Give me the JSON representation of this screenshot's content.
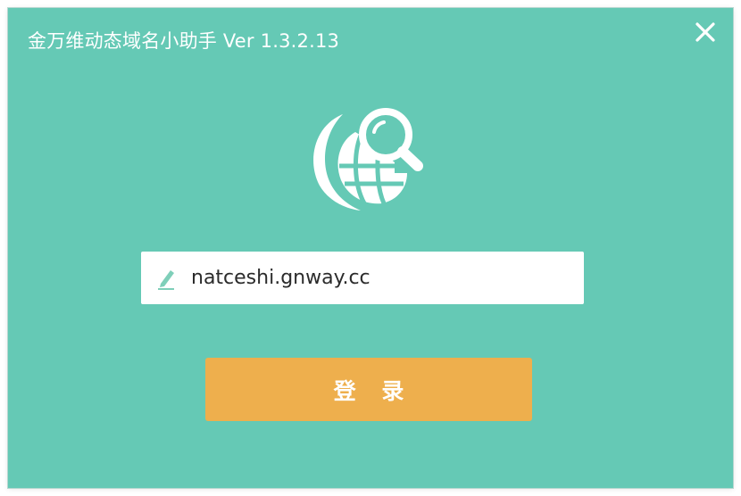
{
  "window": {
    "title": "金万维动态域名小助手 Ver 1.3.2.13",
    "background_color": "#65c9b5"
  },
  "titlebar": {
    "close_icon": "close-icon"
  },
  "logo": {
    "icon": "globe-search-icon"
  },
  "login_form": {
    "domain_value": "natceshi.gnway.cc",
    "field_icon": "pencil-icon",
    "login_label": "登 录",
    "login_color": "#eeaf4d"
  }
}
